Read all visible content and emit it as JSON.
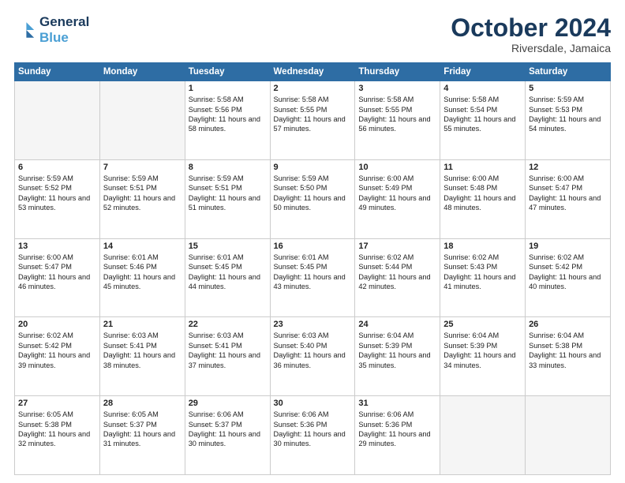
{
  "logo": {
    "line1": "General",
    "line2": "Blue"
  },
  "title": "October 2024",
  "subtitle": "Riversdale, Jamaica",
  "header_days": [
    "Sunday",
    "Monday",
    "Tuesday",
    "Wednesday",
    "Thursday",
    "Friday",
    "Saturday"
  ],
  "weeks": [
    [
      {
        "day": "",
        "sunrise": "",
        "sunset": "",
        "daylight": ""
      },
      {
        "day": "",
        "sunrise": "",
        "sunset": "",
        "daylight": ""
      },
      {
        "day": "1",
        "sunrise": "Sunrise: 5:58 AM",
        "sunset": "Sunset: 5:56 PM",
        "daylight": "Daylight: 11 hours and 58 minutes."
      },
      {
        "day": "2",
        "sunrise": "Sunrise: 5:58 AM",
        "sunset": "Sunset: 5:55 PM",
        "daylight": "Daylight: 11 hours and 57 minutes."
      },
      {
        "day": "3",
        "sunrise": "Sunrise: 5:58 AM",
        "sunset": "Sunset: 5:55 PM",
        "daylight": "Daylight: 11 hours and 56 minutes."
      },
      {
        "day": "4",
        "sunrise": "Sunrise: 5:58 AM",
        "sunset": "Sunset: 5:54 PM",
        "daylight": "Daylight: 11 hours and 55 minutes."
      },
      {
        "day": "5",
        "sunrise": "Sunrise: 5:59 AM",
        "sunset": "Sunset: 5:53 PM",
        "daylight": "Daylight: 11 hours and 54 minutes."
      }
    ],
    [
      {
        "day": "6",
        "sunrise": "Sunrise: 5:59 AM",
        "sunset": "Sunset: 5:52 PM",
        "daylight": "Daylight: 11 hours and 53 minutes."
      },
      {
        "day": "7",
        "sunrise": "Sunrise: 5:59 AM",
        "sunset": "Sunset: 5:51 PM",
        "daylight": "Daylight: 11 hours and 52 minutes."
      },
      {
        "day": "8",
        "sunrise": "Sunrise: 5:59 AM",
        "sunset": "Sunset: 5:51 PM",
        "daylight": "Daylight: 11 hours and 51 minutes."
      },
      {
        "day": "9",
        "sunrise": "Sunrise: 5:59 AM",
        "sunset": "Sunset: 5:50 PM",
        "daylight": "Daylight: 11 hours and 50 minutes."
      },
      {
        "day": "10",
        "sunrise": "Sunrise: 6:00 AM",
        "sunset": "Sunset: 5:49 PM",
        "daylight": "Daylight: 11 hours and 49 minutes."
      },
      {
        "day": "11",
        "sunrise": "Sunrise: 6:00 AM",
        "sunset": "Sunset: 5:48 PM",
        "daylight": "Daylight: 11 hours and 48 minutes."
      },
      {
        "day": "12",
        "sunrise": "Sunrise: 6:00 AM",
        "sunset": "Sunset: 5:47 PM",
        "daylight": "Daylight: 11 hours and 47 minutes."
      }
    ],
    [
      {
        "day": "13",
        "sunrise": "Sunrise: 6:00 AM",
        "sunset": "Sunset: 5:47 PM",
        "daylight": "Daylight: 11 hours and 46 minutes."
      },
      {
        "day": "14",
        "sunrise": "Sunrise: 6:01 AM",
        "sunset": "Sunset: 5:46 PM",
        "daylight": "Daylight: 11 hours and 45 minutes."
      },
      {
        "day": "15",
        "sunrise": "Sunrise: 6:01 AM",
        "sunset": "Sunset: 5:45 PM",
        "daylight": "Daylight: 11 hours and 44 minutes."
      },
      {
        "day": "16",
        "sunrise": "Sunrise: 6:01 AM",
        "sunset": "Sunset: 5:45 PM",
        "daylight": "Daylight: 11 hours and 43 minutes."
      },
      {
        "day": "17",
        "sunrise": "Sunrise: 6:02 AM",
        "sunset": "Sunset: 5:44 PM",
        "daylight": "Daylight: 11 hours and 42 minutes."
      },
      {
        "day": "18",
        "sunrise": "Sunrise: 6:02 AM",
        "sunset": "Sunset: 5:43 PM",
        "daylight": "Daylight: 11 hours and 41 minutes."
      },
      {
        "day": "19",
        "sunrise": "Sunrise: 6:02 AM",
        "sunset": "Sunset: 5:42 PM",
        "daylight": "Daylight: 11 hours and 40 minutes."
      }
    ],
    [
      {
        "day": "20",
        "sunrise": "Sunrise: 6:02 AM",
        "sunset": "Sunset: 5:42 PM",
        "daylight": "Daylight: 11 hours and 39 minutes."
      },
      {
        "day": "21",
        "sunrise": "Sunrise: 6:03 AM",
        "sunset": "Sunset: 5:41 PM",
        "daylight": "Daylight: 11 hours and 38 minutes."
      },
      {
        "day": "22",
        "sunrise": "Sunrise: 6:03 AM",
        "sunset": "Sunset: 5:41 PM",
        "daylight": "Daylight: 11 hours and 37 minutes."
      },
      {
        "day": "23",
        "sunrise": "Sunrise: 6:03 AM",
        "sunset": "Sunset: 5:40 PM",
        "daylight": "Daylight: 11 hours and 36 minutes."
      },
      {
        "day": "24",
        "sunrise": "Sunrise: 6:04 AM",
        "sunset": "Sunset: 5:39 PM",
        "daylight": "Daylight: 11 hours and 35 minutes."
      },
      {
        "day": "25",
        "sunrise": "Sunrise: 6:04 AM",
        "sunset": "Sunset: 5:39 PM",
        "daylight": "Daylight: 11 hours and 34 minutes."
      },
      {
        "day": "26",
        "sunrise": "Sunrise: 6:04 AM",
        "sunset": "Sunset: 5:38 PM",
        "daylight": "Daylight: 11 hours and 33 minutes."
      }
    ],
    [
      {
        "day": "27",
        "sunrise": "Sunrise: 6:05 AM",
        "sunset": "Sunset: 5:38 PM",
        "daylight": "Daylight: 11 hours and 32 minutes."
      },
      {
        "day": "28",
        "sunrise": "Sunrise: 6:05 AM",
        "sunset": "Sunset: 5:37 PM",
        "daylight": "Daylight: 11 hours and 31 minutes."
      },
      {
        "day": "29",
        "sunrise": "Sunrise: 6:06 AM",
        "sunset": "Sunset: 5:37 PM",
        "daylight": "Daylight: 11 hours and 30 minutes."
      },
      {
        "day": "30",
        "sunrise": "Sunrise: 6:06 AM",
        "sunset": "Sunset: 5:36 PM",
        "daylight": "Daylight: 11 hours and 30 minutes."
      },
      {
        "day": "31",
        "sunrise": "Sunrise: 6:06 AM",
        "sunset": "Sunset: 5:36 PM",
        "daylight": "Daylight: 11 hours and 29 minutes."
      },
      {
        "day": "",
        "sunrise": "",
        "sunset": "",
        "daylight": ""
      },
      {
        "day": "",
        "sunrise": "",
        "sunset": "",
        "daylight": ""
      }
    ]
  ]
}
